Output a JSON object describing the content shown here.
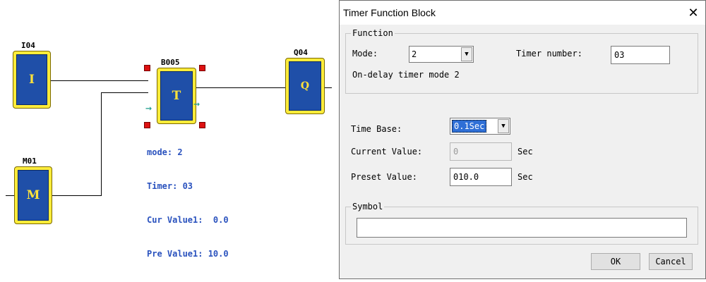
{
  "ladder": {
    "blocks": [
      {
        "id": "i04",
        "label": "I04",
        "letter": "I"
      },
      {
        "id": "m01",
        "label": "M01",
        "letter": "M"
      },
      {
        "id": "b005",
        "label": "B005",
        "letter": "T"
      },
      {
        "id": "q04",
        "label": "Q04",
        "letter": "Q"
      }
    ],
    "timer_info": {
      "mode": "mode: 2",
      "timer": "Timer: 03",
      "cur": "Cur Value1:  0.0",
      "pre": "Pre Value1: 10.0"
    },
    "colors": {
      "block_frame": "#ffec3a",
      "block_fill": "#1f4fa8",
      "info_text": "#2a52be",
      "handle": "#dd1111"
    }
  },
  "dialog": {
    "title": "Timer Function Block",
    "close_icon": "close-icon",
    "function_group": {
      "label": "Function",
      "mode_label": "Mode:",
      "mode_value": "2",
      "timer_number_label": "Timer number:",
      "timer_number_value": "03",
      "description": "On-delay timer mode 2"
    },
    "time_base_label": "Time Base:",
    "time_base_value": "0.1Sec",
    "current_value_label": "Current Value:",
    "current_value": "0",
    "current_unit": "Sec",
    "preset_value_label": "Preset Value:",
    "preset_value": "010.0",
    "preset_unit": "Sec",
    "symbol_group": {
      "label": "Symbol",
      "value": ""
    },
    "ok_label": "OK",
    "cancel_label": "Cancel"
  }
}
